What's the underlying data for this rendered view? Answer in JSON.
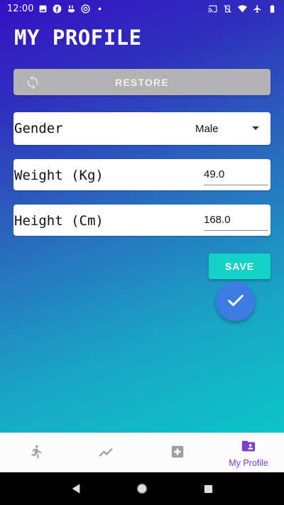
{
  "status_bar": {
    "time": "12:00",
    "left_icons": [
      "image-icon",
      "facebook-icon",
      "fitness-icon",
      "at-sign-icon",
      "dot-icon"
    ],
    "right_icons": [
      "cast-icon",
      "vibrate-off-icon",
      "wifi-icon",
      "airplane-icon",
      "battery-icon"
    ]
  },
  "page": {
    "title": "MY PROFILE"
  },
  "restore": {
    "label": "RESTORE",
    "icon": "sync-icon"
  },
  "gender": {
    "label": "Gender",
    "value": "Male"
  },
  "weight": {
    "label": "Weight (Kg)",
    "value": "49.0"
  },
  "height": {
    "label": "Height (Cm)",
    "value": "168.0"
  },
  "save": {
    "label": "SAVE"
  },
  "fab": {
    "icon": "check-icon"
  },
  "bottom_nav": {
    "items": [
      {
        "icon": "run-icon",
        "label": ""
      },
      {
        "icon": "trend-icon",
        "label": ""
      },
      {
        "icon": "medical-plus-icon",
        "label": ""
      },
      {
        "icon": "profile-folder-icon",
        "label": "My Profile"
      }
    ],
    "active_color": "#7e3ec6",
    "inactive_color": "#9e9e9e"
  },
  "colors": {
    "gradient_top": "#3411c4",
    "gradient_bottom": "#05d6c8",
    "restore_bg": "#b3b3b5",
    "save_bg": "#14d2c4",
    "fab_bg": "#3c7be2"
  }
}
